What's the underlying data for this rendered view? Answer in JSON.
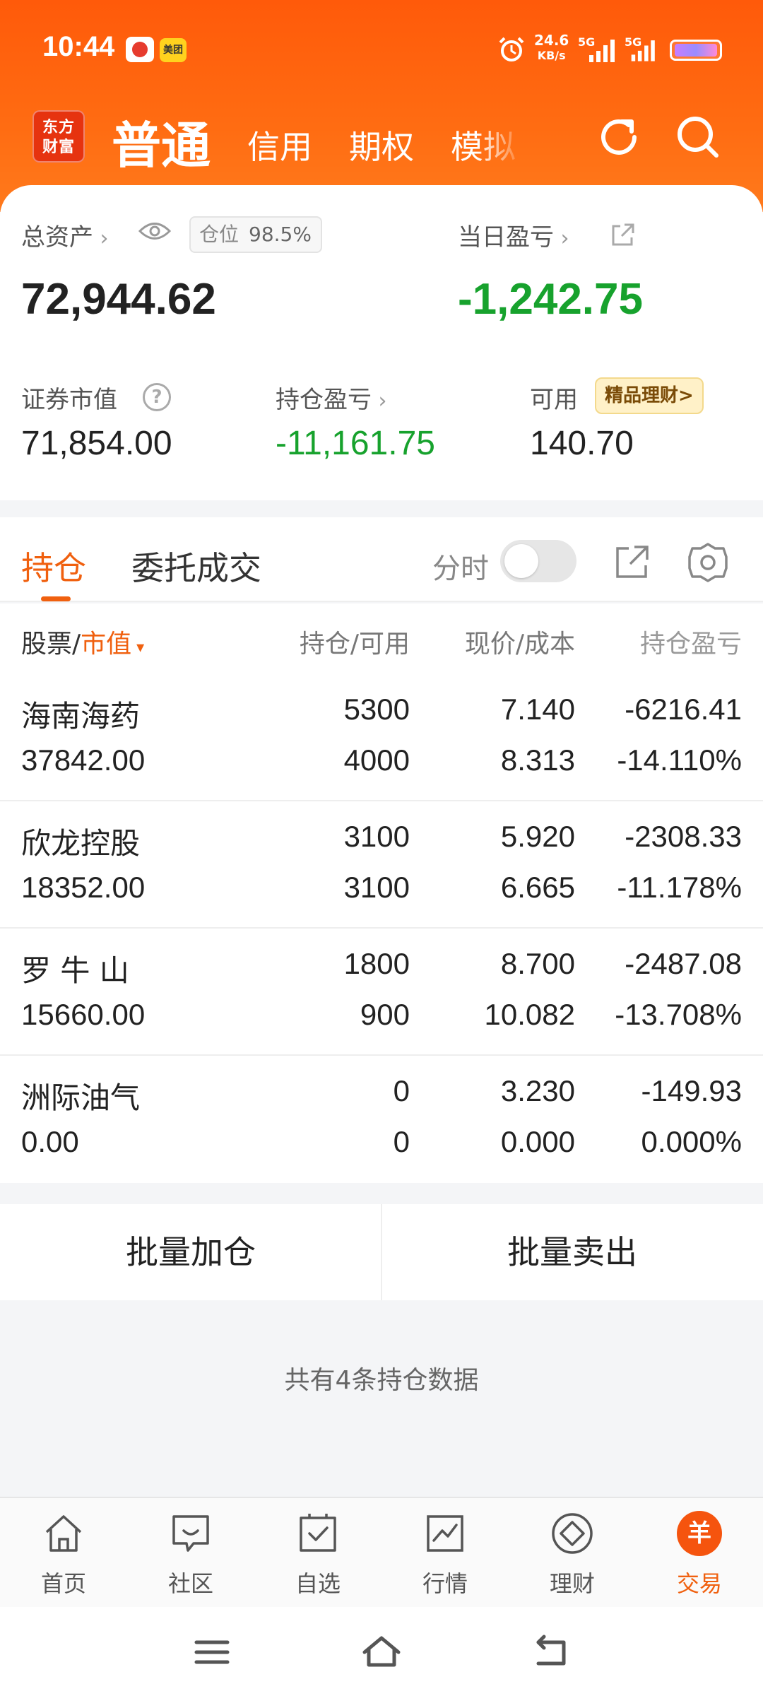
{
  "status_bar": {
    "time": "10:44",
    "app2_label": "美团",
    "net_speed_value": "24.6",
    "net_speed_unit": "KB/s",
    "sim1": "5G",
    "sim2": "5G"
  },
  "app_bar": {
    "logo_line1": "东方",
    "logo_line2": "财富",
    "mode_title": "普通",
    "tabs": [
      "信用",
      "期权",
      "模拟"
    ]
  },
  "summary": {
    "total_assets_label": "总资产",
    "position_label": "仓位",
    "position_value": "98.5%",
    "total_assets_value": "72,944.62",
    "daily_pnl_label": "当日盈亏",
    "daily_pnl_value": "-1,242.75",
    "market_value_label": "证券市值",
    "market_value": "71,854.00",
    "holding_pnl_label": "持仓盈亏",
    "holding_pnl_value": "-11,161.75",
    "available_label": "可用",
    "available_value": "140.70",
    "promo_label": "精品理财>"
  },
  "tabs": {
    "holdings": "持仓",
    "orders": "委托成交",
    "timeshare_label": "分时"
  },
  "table": {
    "headers": {
      "col1_a": "股票/",
      "col1_b": "市值",
      "col2": "持仓/可用",
      "col3": "现价/成本",
      "col4": "持仓盈亏"
    },
    "rows": [
      {
        "name": "海南海药",
        "market_value": "37842.00",
        "position": "5300",
        "available": "4000",
        "price": "7.140",
        "cost": "8.313",
        "pnl": "-6216.41",
        "pnl_pct": "-14.110%"
      },
      {
        "name": "欣龙控股",
        "market_value": "18352.00",
        "position": "3100",
        "available": "3100",
        "price": "5.920",
        "cost": "6.665",
        "pnl": "-2308.33",
        "pnl_pct": "-11.178%"
      },
      {
        "name": "罗 牛 山",
        "market_value": "15660.00",
        "position": "1800",
        "available": "900",
        "price": "8.700",
        "cost": "10.082",
        "pnl": "-2487.08",
        "pnl_pct": "-13.708%"
      },
      {
        "name": "洲际油气",
        "market_value": "0.00",
        "position": "0",
        "available": "0",
        "price": "3.230",
        "cost": "0.000",
        "pnl": "-149.93",
        "pnl_pct": "0.000%"
      }
    ]
  },
  "batch": {
    "add": "批量加仓",
    "sell": "批量卖出"
  },
  "footer_summary": "共有4条持仓数据",
  "bottom_nav": [
    {
      "label": "首页",
      "icon": "home-icon"
    },
    {
      "label": "社区",
      "icon": "chat-icon"
    },
    {
      "label": "自选",
      "icon": "watchlist-icon"
    },
    {
      "label": "行情",
      "icon": "chart-icon"
    },
    {
      "label": "理财",
      "icon": "diamond-icon"
    },
    {
      "label": "交易",
      "icon": "trade-icon",
      "glyph": "羊"
    }
  ],
  "colors": {
    "brand_orange": "#ff5a0a",
    "accent_orange": "#f0600f",
    "loss_green": "#17a22d"
  }
}
